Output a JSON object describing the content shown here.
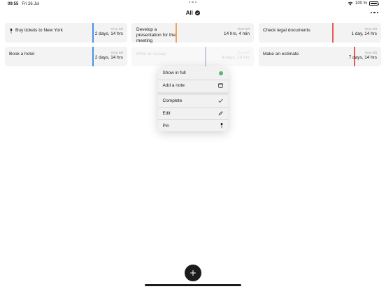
{
  "status_bar": {
    "time": "09:55",
    "date": "Fri 26 Jul",
    "battery": "100 %"
  },
  "nav": {
    "title": "All",
    "icons": {
      "filter": "filter-check-icon",
      "more": "ellipsis-icon"
    }
  },
  "tasks": [
    {
      "title": "Buy tickets to New York",
      "pinned": true,
      "time_left_label": "Time left",
      "time_left": "2 days, 14 hrs",
      "accent": "#4a8fe7"
    },
    {
      "title": "Develop a presentation for the meeting",
      "pinned": false,
      "time_left_label": "Time left",
      "time_left": "14 hrs, 4 min",
      "accent": "#f0a35b"
    },
    {
      "title": "Check legal documents",
      "pinned": false,
      "time_left_label": "Time left",
      "time_left": "1 day, 14 hrs",
      "accent": "#e85a5a"
    },
    {
      "title": "Book a hotel",
      "pinned": false,
      "time_left_label": "Time left",
      "time_left": "2 days, 14 hrs",
      "accent": "#4a8fe7"
    },
    {
      "title": "Write an essay",
      "pinned": false,
      "time_left_label": "Time left",
      "time_left": "4 days, 14 hrs",
      "accent": "#c8cfd8"
    },
    {
      "title": "Make an estimate",
      "pinned": false,
      "time_left_label": "Time left",
      "time_left": "7 days, 14 hrs",
      "accent": "#e85a5a"
    }
  ],
  "context_menu": {
    "items": [
      {
        "label": "Show in full",
        "icon": "green-dot-icon",
        "color": "#5fb37c"
      },
      {
        "label": "Add a note",
        "icon": "calendar-icon"
      },
      {
        "label": "Complete",
        "icon": "checkmark-icon"
      },
      {
        "label": "Edit",
        "icon": "pencil-icon"
      },
      {
        "label": "Pin",
        "icon": "pin-icon"
      }
    ]
  },
  "bottom": {
    "add_icon": "plus-icon"
  }
}
